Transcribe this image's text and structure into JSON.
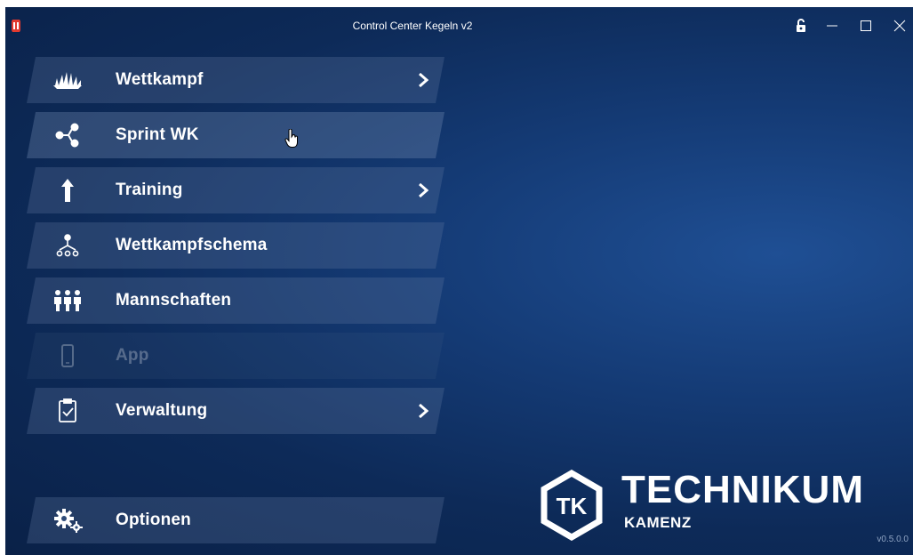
{
  "window": {
    "title": "Control Center Kegeln v2",
    "controls": [
      "lock-icon",
      "minimize-icon",
      "maximize-icon",
      "close-icon"
    ]
  },
  "menu": {
    "items": [
      {
        "label": "Wettkampf",
        "icon": "bowling-pins-icon",
        "has_submenu": true,
        "state": "normal"
      },
      {
        "label": "Sprint WK",
        "icon": "share-nodes-icon",
        "has_submenu": false,
        "state": "hover"
      },
      {
        "label": "Training",
        "icon": "arrow-up-icon",
        "has_submenu": true,
        "state": "normal"
      },
      {
        "label": "Wettkampfschema",
        "icon": "tree-diagram-icon",
        "has_submenu": false,
        "state": "normal"
      },
      {
        "label": "Mannschaften",
        "icon": "team-icon",
        "has_submenu": false,
        "state": "normal"
      },
      {
        "label": "App",
        "icon": "phone-icon",
        "has_submenu": false,
        "state": "disabled"
      },
      {
        "label": "Verwaltung",
        "icon": "clipboard-check-icon",
        "has_submenu": true,
        "state": "normal"
      }
    ],
    "options": {
      "label": "Optionen",
      "icon": "gears-icon"
    }
  },
  "logo": {
    "mark": "TK",
    "name": "TECHNIKUM",
    "sub": "KAMENZ"
  },
  "version": "v0.5.0.0",
  "colors": {
    "background": "#0d2a58",
    "accent": "#1f4f94",
    "text": "#ffffff"
  }
}
